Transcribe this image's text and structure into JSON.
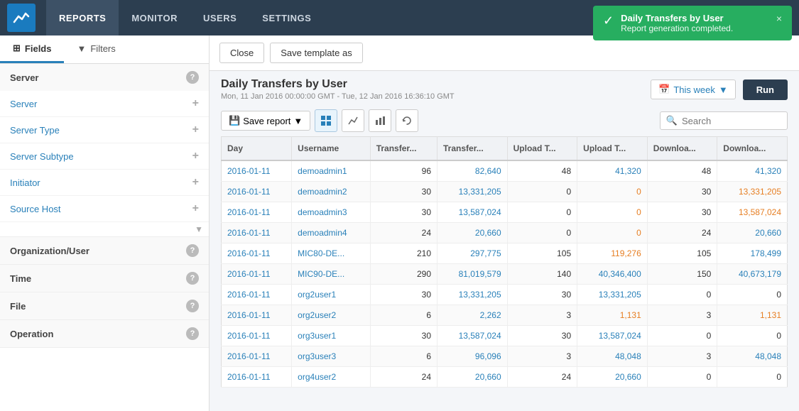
{
  "nav": {
    "items": [
      "REPORTS",
      "MONITOR",
      "USERS",
      "SETTINGS"
    ],
    "active": "REPORTS"
  },
  "toast": {
    "title": "Daily Transfers by User",
    "subtitle": "Report generation completed.",
    "close": "×",
    "check": "✓"
  },
  "sidebar": {
    "tab_fields": "Fields",
    "tab_filters": "Filters",
    "groups": [
      {
        "name": "Server",
        "has_info": true
      },
      {
        "name": "Organization/User",
        "has_info": true
      },
      {
        "name": "Time",
        "has_info": true
      },
      {
        "name": "File",
        "has_info": true
      },
      {
        "name": "Operation",
        "has_info": true
      }
    ],
    "fields": [
      {
        "name": "Server"
      },
      {
        "name": "Server Type"
      },
      {
        "name": "Server Subtype"
      },
      {
        "name": "Initiator"
      },
      {
        "name": "Source Host"
      }
    ]
  },
  "report": {
    "title": "Daily Transfers by User",
    "date_range": "Mon, 11 Jan 2016 00:00:00 GMT - Tue, 12 Jan 2016 16:36:10 GMT",
    "this_week": "This week",
    "run_btn": "Run"
  },
  "toolbar": {
    "close_btn": "Close",
    "save_template_btn": "Save template as",
    "save_report_btn": "Save report",
    "search_placeholder": "Search"
  },
  "table": {
    "columns": [
      "Day",
      "Username",
      "Transfer...",
      "Transfer...",
      "Upload T...",
      "Upload T...",
      "Downloa...",
      "Downloa..."
    ],
    "rows": [
      {
        "day": "2016-01-11",
        "username": "demoadmin1",
        "t1": "96",
        "t2": "82,640",
        "u1": "48",
        "u2": "41,320",
        "d1": "48",
        "d2": "41,320",
        "u2_orange": false,
        "d2_orange": false
      },
      {
        "day": "2016-01-11",
        "username": "demoadmin2",
        "t1": "30",
        "t2": "13,331,205",
        "u1": "0",
        "u2": "0",
        "d1": "30",
        "d2": "13,331,205",
        "u2_orange": true,
        "d2_orange": true
      },
      {
        "day": "2016-01-11",
        "username": "demoadmin3",
        "t1": "30",
        "t2": "13,587,024",
        "u1": "0",
        "u2": "0",
        "d1": "30",
        "d2": "13,587,024",
        "u2_orange": true,
        "d2_orange": true
      },
      {
        "day": "2016-01-11",
        "username": "demoadmin4",
        "t1": "24",
        "t2": "20,660",
        "u1": "0",
        "u2": "0",
        "d1": "24",
        "d2": "20,660",
        "u2_orange": true,
        "d2_orange": false
      },
      {
        "day": "2016-01-11",
        "username": "MIC80-DE...",
        "t1": "210",
        "t2": "297,775",
        "u1": "105",
        "u2": "119,276",
        "d1": "105",
        "d2": "178,499",
        "u2_orange": true,
        "d2_orange": false
      },
      {
        "day": "2016-01-11",
        "username": "MIC90-DE...",
        "t1": "290",
        "t2": "81,019,579",
        "u1": "140",
        "u2": "40,346,400",
        "d1": "150",
        "d2": "40,673,179",
        "u2_orange": false,
        "d2_orange": false
      },
      {
        "day": "2016-01-11",
        "username": "org2user1",
        "t1": "30",
        "t2": "13,331,205",
        "u1": "30",
        "u2": "13,331,205",
        "d1": "0",
        "d2": "0",
        "u2_orange": false,
        "d2_orange": false
      },
      {
        "day": "2016-01-11",
        "username": "org2user2",
        "t1": "6",
        "t2": "2,262",
        "u1": "3",
        "u2": "1,131",
        "d1": "3",
        "d2": "1,131",
        "u2_orange": true,
        "d2_orange": true
      },
      {
        "day": "2016-01-11",
        "username": "org3user1",
        "t1": "30",
        "t2": "13,587,024",
        "u1": "30",
        "u2": "13,587,024",
        "d1": "0",
        "d2": "0",
        "u2_orange": false,
        "d2_orange": false
      },
      {
        "day": "2016-01-11",
        "username": "org3user3",
        "t1": "6",
        "t2": "96,096",
        "u1": "3",
        "u2": "48,048",
        "d1": "3",
        "d2": "48,048",
        "u2_orange": false,
        "d2_orange": false
      },
      {
        "day": "2016-01-11",
        "username": "org4user2",
        "t1": "24",
        "t2": "20,660",
        "u1": "24",
        "u2": "20,660",
        "d1": "0",
        "d2": "0",
        "u2_orange": false,
        "d2_orange": false
      }
    ]
  }
}
